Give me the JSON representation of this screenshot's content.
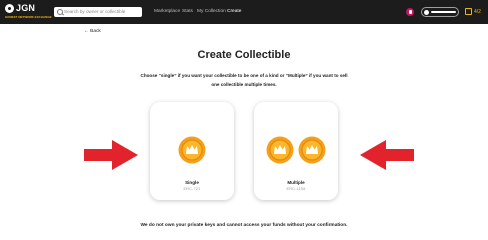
{
  "header": {
    "logo_text": "JGN",
    "logo_subtext": "HONEST NETWORK EXCHANGE",
    "search_placeholder": "Search by owner or collectible",
    "nav": [
      {
        "label": "Marketplace",
        "active": false
      },
      {
        "label": "Stats",
        "active": false
      },
      {
        "label": "My Collection",
        "active": false
      },
      {
        "label": "Create",
        "active": true
      }
    ],
    "wallet_count": "4/2"
  },
  "back_label": "← Back",
  "title": "Create Collectible",
  "description": "Choose “single” if you want your collectible to be one of a kind or “Multiple” if you want to sell one collectible multiple times.",
  "options": [
    {
      "label": "Single",
      "sublabel": "ERC-721",
      "icon": "single-crown-coin-icon"
    },
    {
      "label": "Multiple",
      "sublabel": "ERC-1155",
      "icon": "double-crown-coin-icon"
    }
  ],
  "footer": "We do not own your private keys and cannot access your funds without your confirmation.",
  "colors": {
    "topbar": "#1c1c1c",
    "accent": "#f2b705",
    "arrow": "#e3232c",
    "coin": "#f5a01a"
  }
}
